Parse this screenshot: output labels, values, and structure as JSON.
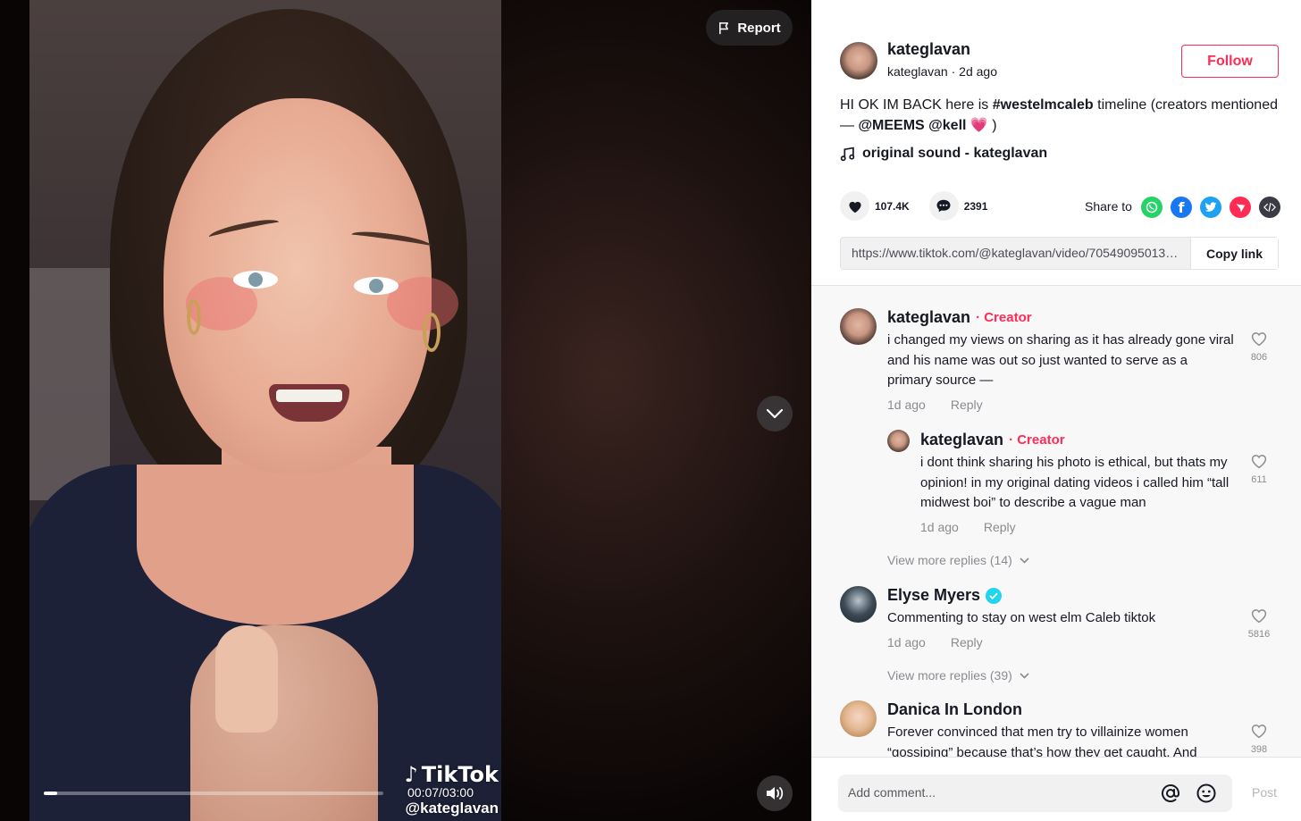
{
  "video": {
    "report_label": "Report",
    "watermark_brand": "TikTok",
    "watermark_handle": "@kateglavan",
    "time_display": "00:07/03:00",
    "progress_fraction": 0.039
  },
  "post": {
    "author_name": "kateglavan",
    "author_sub": "kateglavan · 2d ago",
    "follow_label": "Follow",
    "caption_pre": "HI OK IM BACK here is ",
    "caption_hashtag": "#westelmcaleb",
    "caption_mid": " timeline (creators mentioned — ",
    "caption_mentions": "@MEEMS @kell",
    "caption_emoji": "💗",
    "caption_end": " )",
    "sound": "original sound - kateglavan",
    "likes": "107.4K",
    "comments_count": "2391",
    "share_label": "Share to",
    "share_icons": [
      "whatsapp-icon",
      "facebook-icon",
      "twitter-icon",
      "telegram-icon",
      "embed-icon"
    ],
    "link_url": "https://www.tiktok.com/@kateglavan/video/705490950134...",
    "copy_label": "Copy link"
  },
  "comments": [
    {
      "name": "kateglavan",
      "badge": "· Creator",
      "text": "i changed my views on sharing as it has already gone viral and his name was out so just wanted to serve as a primary source —",
      "time": "1d ago",
      "reply": "Reply",
      "likes": "806"
    },
    {
      "name": "kateglavan",
      "badge": "· Creator",
      "text": "i dont think sharing his photo is ethical, but thats my opinion! in my original dating videos i called him “tall midwest boi” to describe a vague man",
      "time": "1d ago",
      "reply": "Reply",
      "likes": "611"
    },
    {
      "name": "Elyse Myers",
      "text": "Commenting to stay on west elm Caleb tiktok",
      "time": "1d ago",
      "reply": "Reply",
      "likes": "5816"
    },
    {
      "name": "Danica In London",
      "text": "Forever convinced that men try to villainize women “gossiping” because that’s how they get caught. And",
      "likes": "398"
    }
  ],
  "view_more": [
    "View more replies (14)",
    "View more replies (39)"
  ],
  "comment_box": {
    "placeholder": "Add comment...",
    "post_label": "Post"
  },
  "colors": {
    "accent": "#fe2c55",
    "verified": "#20d5ec",
    "whatsapp": "#25d366",
    "facebook": "#1877f2",
    "twitter": "#1da1f2",
    "telegram": "#fe2c55",
    "embed": "#3a3b44"
  }
}
